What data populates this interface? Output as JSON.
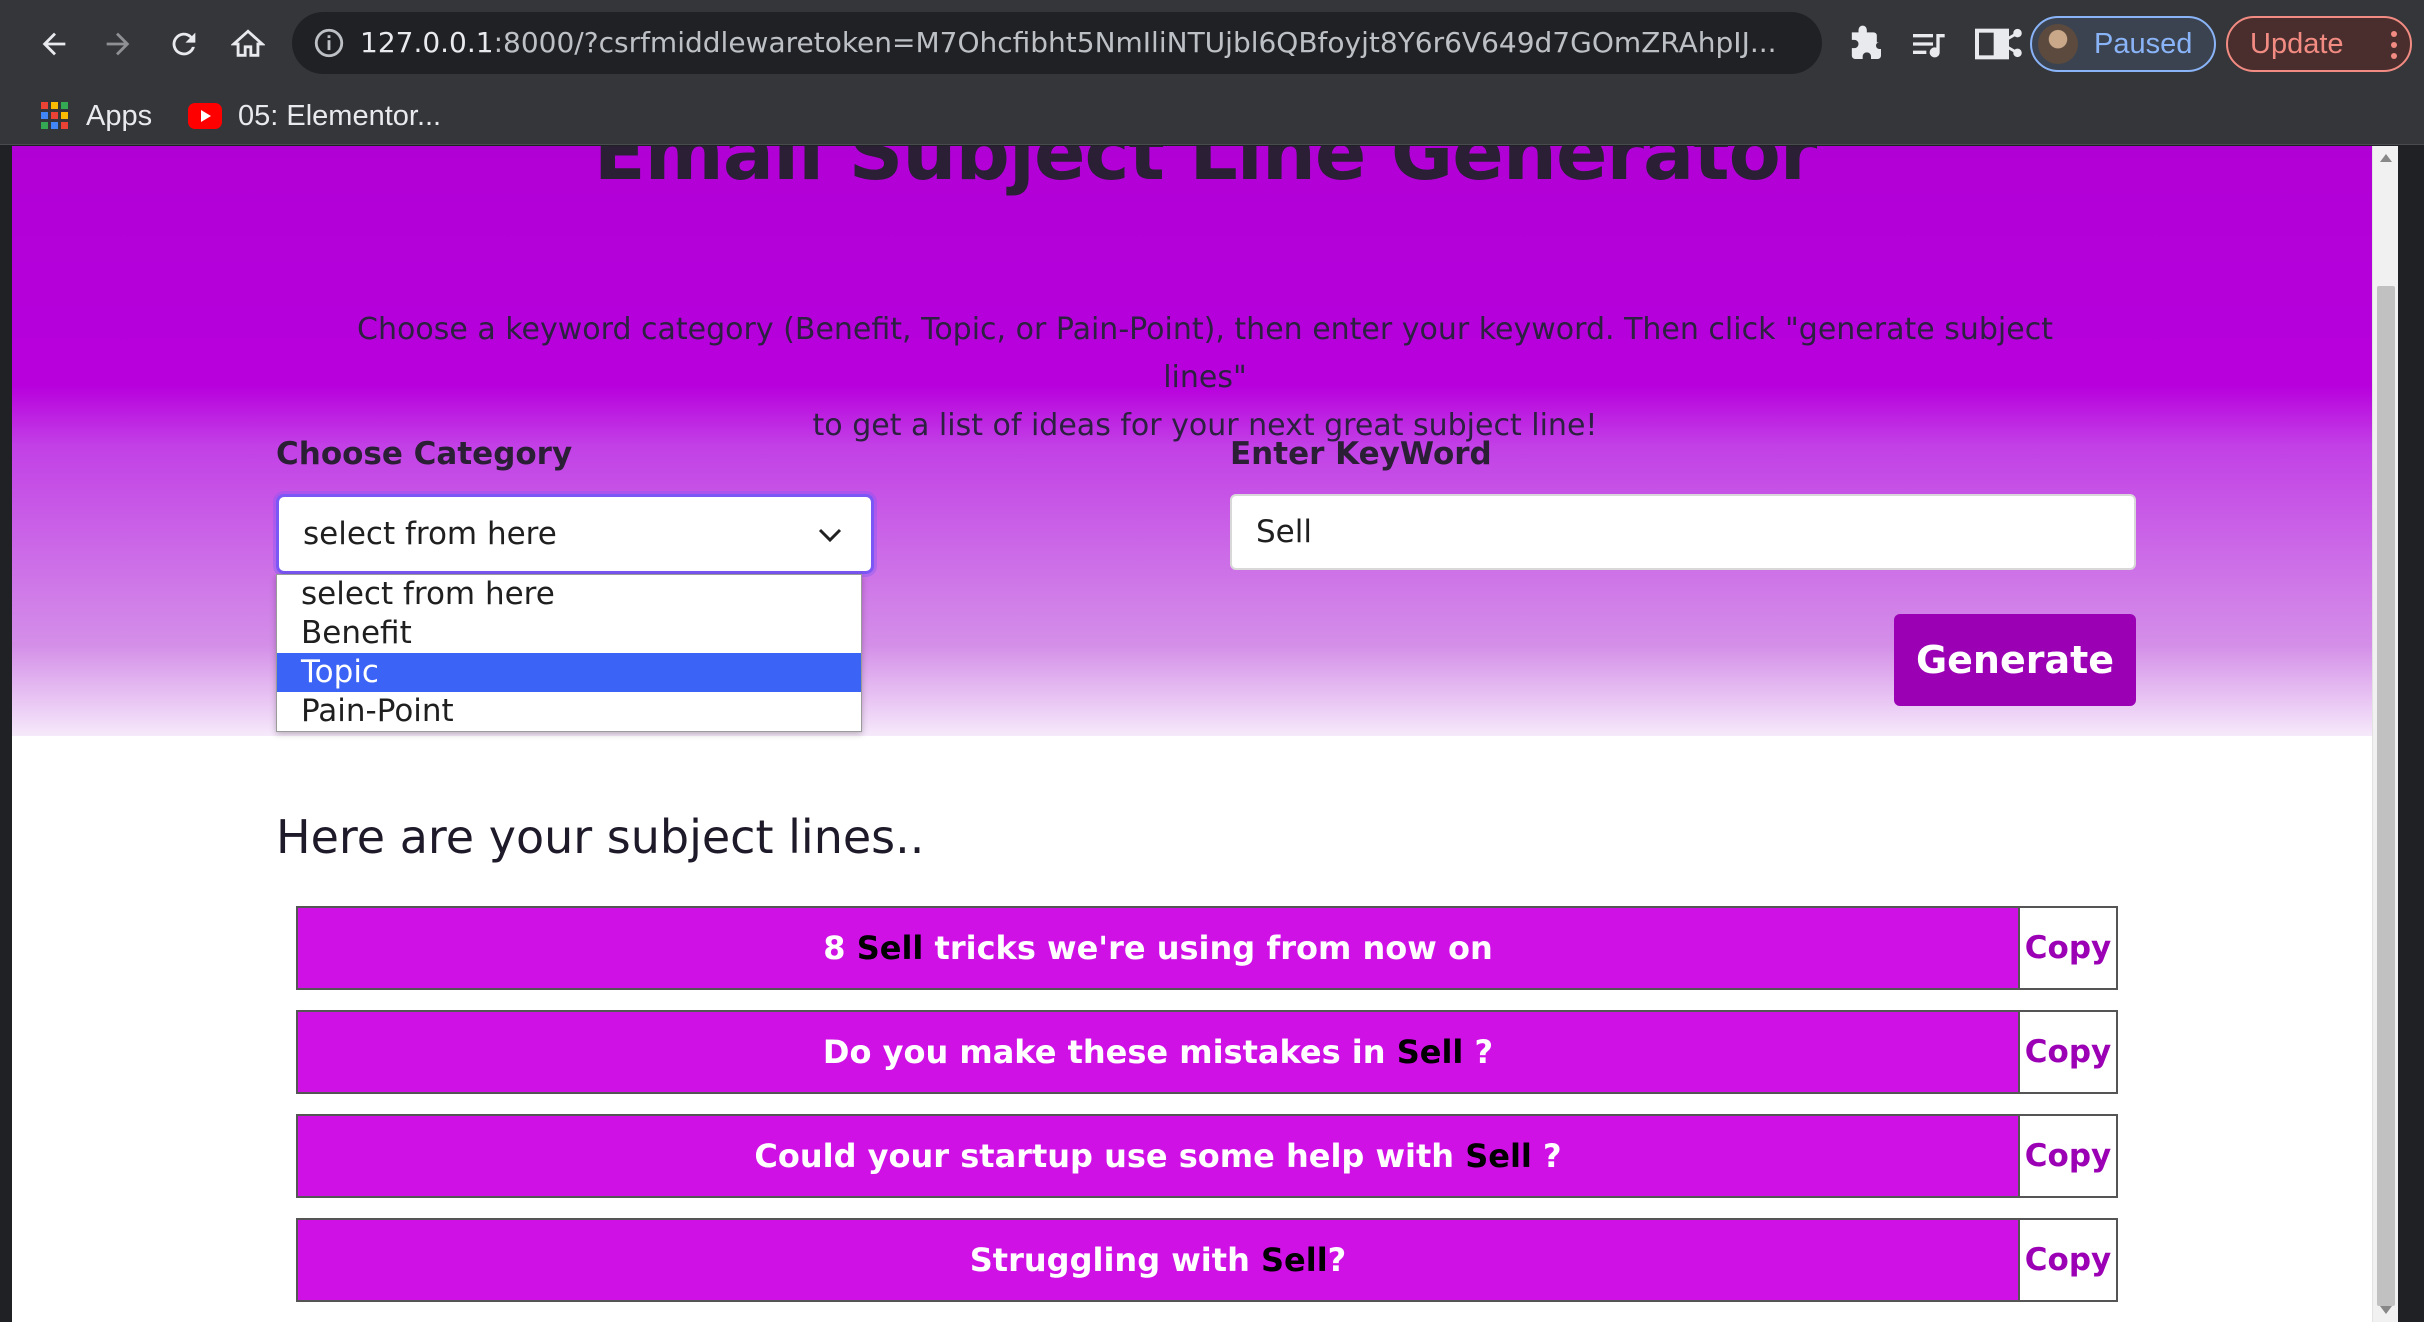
{
  "browser": {
    "url_host": "127.0.0.1",
    "url_rest": ":8000/?csrfmiddlewaretoken=M7Ohcfibht5NmIliNTUjbl6QBfoyjt8Y6r6V649d7GOmZRAhpIJ...",
    "profile_label": "Paused",
    "update_label": "Update",
    "bookmarks": [
      {
        "label": "Apps",
        "icon": "apps-grid-icon"
      },
      {
        "label": "05: Elementor...",
        "icon": "youtube-icon"
      }
    ]
  },
  "page": {
    "title": "Email Subject Line Generator",
    "intro_line1": "Choose a keyword category (Benefit, Topic, or Pain-Point), then enter your keyword. Then click \"generate subject lines\"",
    "intro_line2": "to get a list of ideas for your next great subject line!",
    "category_label": "Choose Category",
    "category_value": "select from here",
    "category_options": [
      "select from here",
      "Benefit",
      "Topic",
      "Pain-Point"
    ],
    "highlighted_option": "Topic",
    "keyword_label": "Enter KeyWord",
    "keyword_value": "Sell",
    "generate_label": "Generate",
    "results_heading": "Here are your subject lines.."
  },
  "results": [
    {
      "before": "8 ",
      "keyword": "Sell",
      "after": " tricks we're using from now on",
      "copy_label": "Copy"
    },
    {
      "before": "Do you make these mistakes in ",
      "keyword": "Sell",
      "after": " ?",
      "copy_label": "Copy"
    },
    {
      "before": "Could your startup use some help with ",
      "keyword": "Sell",
      "after": " ?",
      "copy_label": "Copy"
    },
    {
      "before": "Struggling with ",
      "keyword": "Sell",
      "after": "?",
      "copy_label": "Copy"
    }
  ],
  "colors": {
    "hero_purple": "#b800dd",
    "result_row": "#cf11e6",
    "button_purple": "#9b00b5",
    "option_highlight": "#3b63f5"
  }
}
